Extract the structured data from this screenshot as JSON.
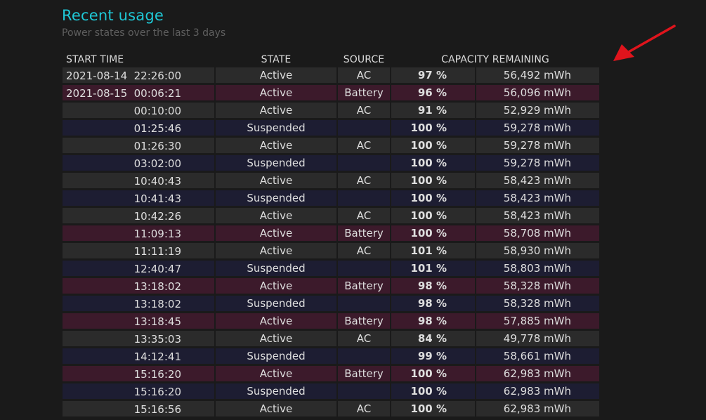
{
  "header": {
    "title": "Recent usage",
    "subtitle": "Power states over the last 3 days"
  },
  "table": {
    "columns": [
      "START TIME",
      "STATE",
      "SOURCE",
      "CAPACITY REMAINING"
    ],
    "rows": [
      {
        "date": "2021-08-14",
        "time": "22:26:00",
        "state": "Active",
        "source": "AC",
        "percent": "97 %",
        "capacity": "56,492 mWh",
        "kind": "ac"
      },
      {
        "date": "2021-08-15",
        "time": "00:06:21",
        "state": "Active",
        "source": "Battery",
        "percent": "96 %",
        "capacity": "56,096 mWh",
        "kind": "bat"
      },
      {
        "date": "",
        "time": "00:10:00",
        "state": "Active",
        "source": "AC",
        "percent": "91 %",
        "capacity": "52,929 mWh",
        "kind": "ac"
      },
      {
        "date": "",
        "time": "01:25:46",
        "state": "Suspended",
        "source": "",
        "percent": "100 %",
        "capacity": "59,278 mWh",
        "kind": "sus"
      },
      {
        "date": "",
        "time": "01:26:30",
        "state": "Active",
        "source": "AC",
        "percent": "100 %",
        "capacity": "59,278 mWh",
        "kind": "ac"
      },
      {
        "date": "",
        "time": "03:02:00",
        "state": "Suspended",
        "source": "",
        "percent": "100 %",
        "capacity": "59,278 mWh",
        "kind": "sus"
      },
      {
        "date": "",
        "time": "10:40:43",
        "state": "Active",
        "source": "AC",
        "percent": "100 %",
        "capacity": "58,423 mWh",
        "kind": "ac"
      },
      {
        "date": "",
        "time": "10:41:43",
        "state": "Suspended",
        "source": "",
        "percent": "100 %",
        "capacity": "58,423 mWh",
        "kind": "sus"
      },
      {
        "date": "",
        "time": "10:42:26",
        "state": "Active",
        "source": "AC",
        "percent": "100 %",
        "capacity": "58,423 mWh",
        "kind": "ac"
      },
      {
        "date": "",
        "time": "11:09:13",
        "state": "Active",
        "source": "Battery",
        "percent": "100 %",
        "capacity": "58,708 mWh",
        "kind": "bat"
      },
      {
        "date": "",
        "time": "11:11:19",
        "state": "Active",
        "source": "AC",
        "percent": "101 %",
        "capacity": "58,930 mWh",
        "kind": "ac"
      },
      {
        "date": "",
        "time": "12:40:47",
        "state": "Suspended",
        "source": "",
        "percent": "101 %",
        "capacity": "58,803 mWh",
        "kind": "sus"
      },
      {
        "date": "",
        "time": "13:18:02",
        "state": "Active",
        "source": "Battery",
        "percent": "98 %",
        "capacity": "58,328 mWh",
        "kind": "bat"
      },
      {
        "date": "",
        "time": "13:18:02",
        "state": "Suspended",
        "source": "",
        "percent": "98 %",
        "capacity": "58,328 mWh",
        "kind": "sus"
      },
      {
        "date": "",
        "time": "13:18:45",
        "state": "Active",
        "source": "Battery",
        "percent": "98 %",
        "capacity": "57,885 mWh",
        "kind": "bat"
      },
      {
        "date": "",
        "time": "13:35:03",
        "state": "Active",
        "source": "AC",
        "percent": "84 %",
        "capacity": "49,778 mWh",
        "kind": "ac"
      },
      {
        "date": "",
        "time": "14:12:41",
        "state": "Suspended",
        "source": "",
        "percent": "99 %",
        "capacity": "58,661 mWh",
        "kind": "sus"
      },
      {
        "date": "",
        "time": "15:16:20",
        "state": "Active",
        "source": "Battery",
        "percent": "100 %",
        "capacity": "62,983 mWh",
        "kind": "bat"
      },
      {
        "date": "",
        "time": "15:16:20",
        "state": "Suspended",
        "source": "",
        "percent": "100 %",
        "capacity": "62,983 mWh",
        "kind": "sus"
      },
      {
        "date": "",
        "time": "15:16:56",
        "state": "Active",
        "source": "AC",
        "percent": "100 %",
        "capacity": "62,983 mWh",
        "kind": "ac"
      }
    ]
  },
  "colors": {
    "title": "#1fc8d6",
    "row_ac": "#2b2b2b",
    "row_battery": "#3c1a2b",
    "row_suspended": "#1d1d32",
    "annotation_arrow": "#e0141c"
  },
  "annotation": {
    "icon": "red-arrow-icon"
  }
}
